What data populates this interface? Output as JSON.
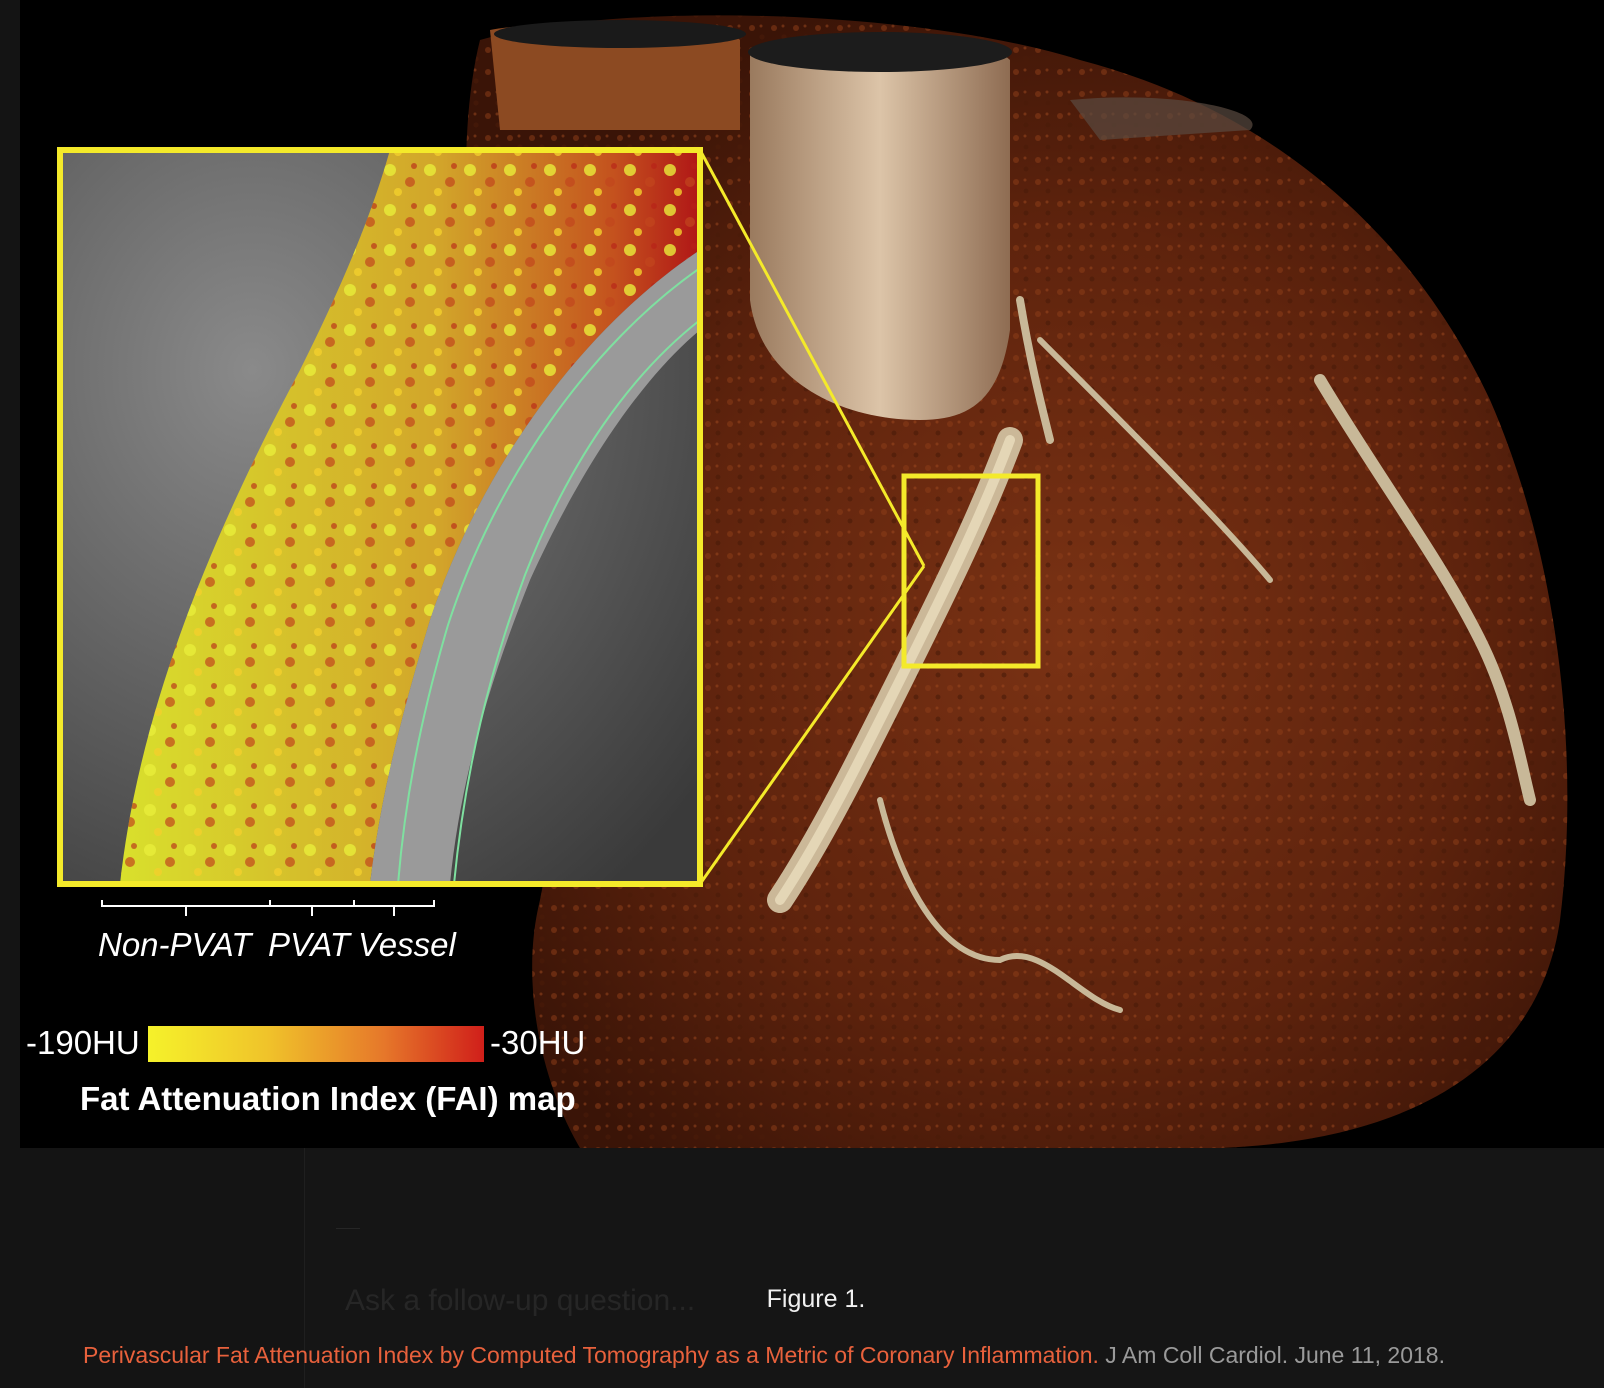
{
  "figure": {
    "inset_labels": {
      "non_pvat": "Non-PVAT",
      "pvat": "PVAT",
      "vessel": "Vessel"
    },
    "legend": {
      "min_label": "-190HU",
      "max_label": "-30HU",
      "title": "Fat Attenuation Index (FAI) map",
      "gradient_colors": [
        "#f5f22a",
        "#f0c42a",
        "#e6782a",
        "#d01f1a"
      ]
    },
    "colors": {
      "highlight_box": "#f4ea2a",
      "tissue": "#6e2a12",
      "vessel": "#d8c8a8"
    }
  },
  "follow_up": {
    "placeholder": "Ask a follow-up question..."
  },
  "caption": {
    "label": "Figure 1.",
    "link_text": "Perivascular Fat Attenuation Index by Computed Tomography as a Metric of Coronary Inflammation.",
    "journal": " J Am Coll Cardiol. June 11, 2018."
  }
}
